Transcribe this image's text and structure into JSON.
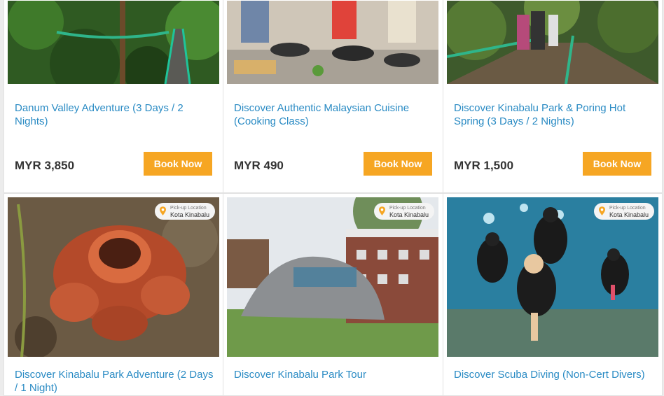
{
  "tours": [
    {
      "title": "Danum Valley Adventure (3 Days / 2 Nights)",
      "price": "MYR 3,850",
      "cta": "Book Now",
      "image": "jungle-canopy-walkway"
    },
    {
      "title": "Discover Authentic Malaysian Cuisine (Cooking Class)",
      "price": "MYR 490",
      "cta": "Book Now",
      "image": "cooking-class"
    },
    {
      "title": "Discover Kinabalu Park & Poring Hot Spring (3 Days / 2 Nights)",
      "price": "MYR 1,500",
      "cta": "Book Now",
      "image": "forest-boardwalk"
    },
    {
      "title": "Discover Kinabalu Park Adventure (2 Days / 1 Night)",
      "badge": {
        "label": "Pick-up Location",
        "value": "Kota Kinabalu"
      },
      "image": "rafflesia-flower"
    },
    {
      "title": "Discover Kinabalu Park Tour",
      "badge": {
        "label": "Pick-up Location",
        "value": "Kota Kinabalu"
      },
      "image": "kinabalu-park-sign-rock"
    },
    {
      "title": "Discover Scuba Diving (Non-Cert Divers)",
      "badge": {
        "label": "Pick-up Location",
        "value": "Kota Kinabalu"
      },
      "image": "scuba-divers"
    }
  ],
  "colors": {
    "accent": "#f6a623",
    "link": "#2a8bc4"
  }
}
